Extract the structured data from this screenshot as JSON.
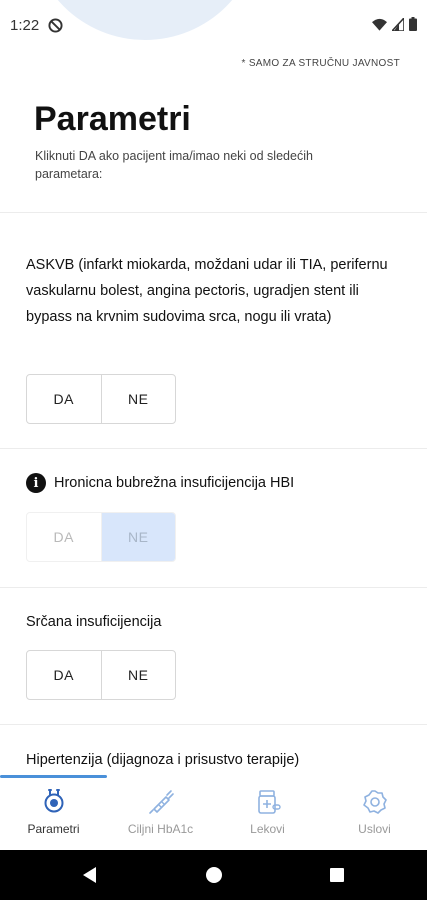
{
  "status_bar": {
    "time": "1:22",
    "icons": [
      "dnd-icon",
      "wifi-icon",
      "signal-icon",
      "battery-icon"
    ]
  },
  "disclaimer": "* SAMO ZA STRUČNU JAVNOST",
  "page": {
    "title": "Parametri",
    "subtitle": "Kliknuti DA ako pacijent ima/imao neki od sledećih parametara:"
  },
  "parameters": [
    {
      "question": "ASKVB (infarkt miokarda, moždani udar ili TIA, perifernu vaskularnu bolest, angina pectoris, ugradjen stent ili bypass na krvnim sudovima srca, nogu ili vrata)",
      "yes_label": "DA",
      "no_label": "NE",
      "selected": null,
      "disabled": false
    },
    {
      "question": "Hronicna bubrežna insuficijencija HBI",
      "has_info_icon": true,
      "yes_label": "DA",
      "no_label": "NE",
      "selected": "NE",
      "disabled": true
    },
    {
      "question": "Srčana insuficijencija",
      "yes_label": "DA",
      "no_label": "NE",
      "selected": null,
      "disabled": false
    },
    {
      "question": "Hipertenzija (dijagnoza i prisustvo terapije)"
    }
  ],
  "bottom_nav": {
    "active_index": 0,
    "items": [
      {
        "label": "Parametri",
        "icon": "stethoscope-icon"
      },
      {
        "label": "Ciljni HbA1c",
        "icon": "syringe-icon"
      },
      {
        "label": "Lekovi",
        "icon": "pill-bottle-icon"
      },
      {
        "label": "Uslovi",
        "icon": "settings-icon"
      }
    ]
  },
  "colors": {
    "accent": "#4a90d9",
    "selected_bg": "#d8e6fb",
    "blob": "#e6eef8"
  }
}
